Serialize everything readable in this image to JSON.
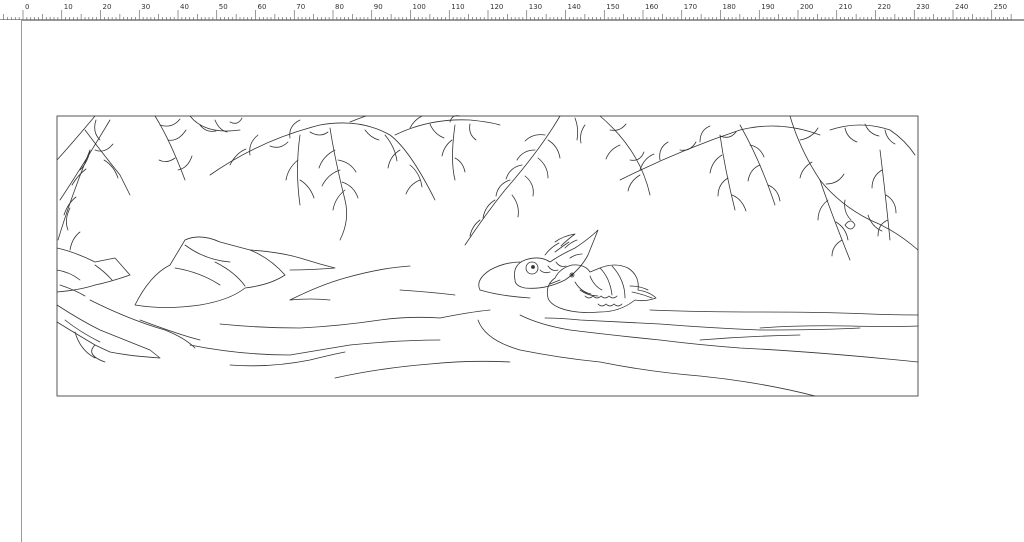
{
  "ruler": {
    "unit_start": 0,
    "unit_end": 250,
    "major_step": 10,
    "labels": [
      "0",
      "10",
      "20",
      "30",
      "40",
      "50",
      "60",
      "70",
      "80",
      "90",
      "100",
      "110",
      "120",
      "130",
      "140",
      "150",
      "160",
      "170",
      "180",
      "190",
      "200",
      "210",
      "220",
      "230",
      "240",
      "250"
    ]
  },
  "drawing": {
    "subject": "line-art illustration",
    "stroke_color": "#333333",
    "frame_color": "#555555"
  }
}
